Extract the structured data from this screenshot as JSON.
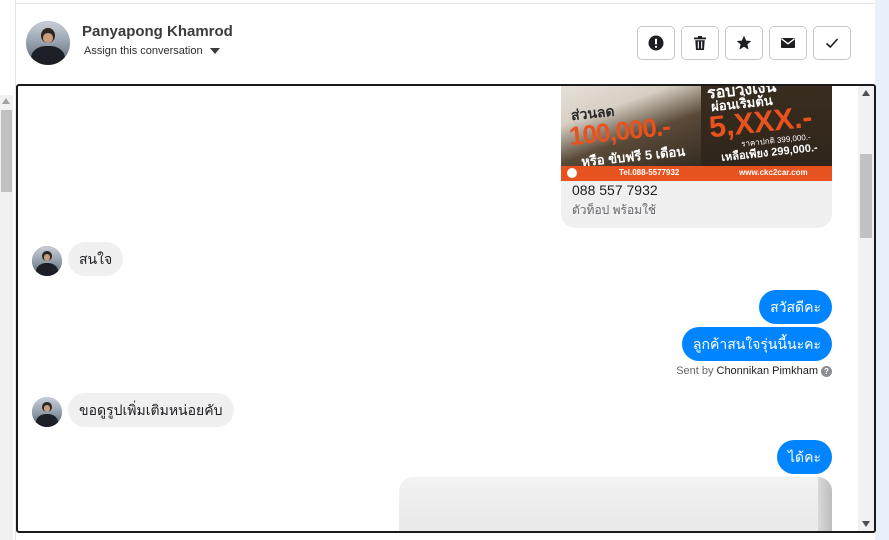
{
  "header": {
    "user_name": "Panyapong Khamrod",
    "assign_label": "Assign this conversation",
    "actions": [
      {
        "name": "report-button",
        "icon": "alert-circle-icon"
      },
      {
        "name": "delete-button",
        "icon": "trash-icon"
      },
      {
        "name": "star-button",
        "icon": "star-icon"
      },
      {
        "name": "mark-unread-button",
        "icon": "envelope-icon"
      },
      {
        "name": "mark-done-button",
        "icon": "checkmark-icon"
      }
    ]
  },
  "ad_card": {
    "image_text": {
      "discount_label": "ส่วนลด",
      "discount_amount": "100,000.-",
      "free_drive": "หรือ ขับฟรี 5 เดือน",
      "headline": "รอบวงเงิน",
      "installment_label": "ผ่อนเริ่มต้น",
      "installment_amount": "5,XXX.-",
      "price_old": "ราคาปกติ 399,000.-",
      "price_new": "เหลือเพียง 299,000.-",
      "phone_banner": "Tel.088-5577932",
      "website": "www.ckc2car.com"
    },
    "phone": "088 557 7932",
    "subtitle": "ตัวท็อป พร้อมใช้"
  },
  "messages": [
    {
      "direction": "incoming",
      "text": "สนใจ"
    },
    {
      "direction": "outgoing",
      "text": "สวัสดีคะ"
    },
    {
      "direction": "outgoing",
      "text": "ลูกค้าสนใจรุ่นนี้นะคะ"
    },
    {
      "direction": "incoming",
      "text": "ขอดูรูปเพิ่มเติมหน่อยคับ"
    },
    {
      "direction": "outgoing",
      "text": "ได้คะ"
    }
  ],
  "sent_by": {
    "prefix": "Sent by",
    "name": "Chonnikan Pimkham",
    "help_glyph": "?"
  },
  "colors": {
    "outgoing_bubble": "#0084ff",
    "incoming_bubble": "#f0f0f0",
    "ad_accent": "#e8521f"
  }
}
